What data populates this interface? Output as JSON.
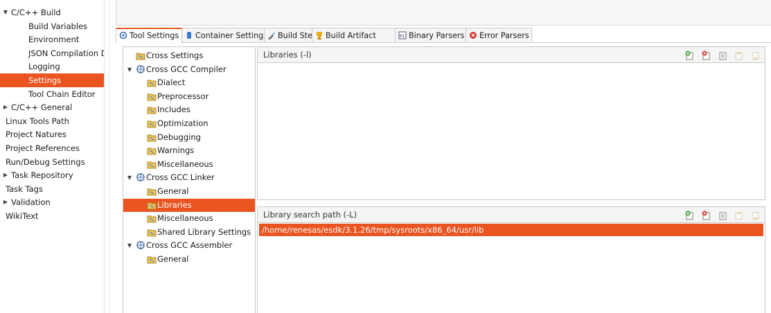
{
  "nav": {
    "items": [
      {
        "label": "C/C++ Build",
        "arrow": "▼",
        "level": 0,
        "selected": false
      },
      {
        "label": "Build Variables",
        "level": 1,
        "selected": false
      },
      {
        "label": "Environment",
        "level": 1,
        "selected": false
      },
      {
        "label": "JSON Compilation D",
        "level": 1,
        "selected": false
      },
      {
        "label": "Logging",
        "level": 1,
        "selected": false
      },
      {
        "label": "Settings",
        "level": 1,
        "selected": true
      },
      {
        "label": "Tool Chain Editor",
        "level": 1,
        "selected": false
      },
      {
        "label": "C/C++ General",
        "arrow": "▶",
        "level": 0,
        "selected": false
      },
      {
        "label": "Linux Tools Path",
        "level": 0,
        "selected": false
      },
      {
        "label": "Project Natures",
        "level": 0,
        "selected": false
      },
      {
        "label": "Project References",
        "level": 0,
        "selected": false
      },
      {
        "label": "Run/Debug Settings",
        "level": 0,
        "selected": false
      },
      {
        "label": "Task Repository",
        "arrow": "▶",
        "level": 0,
        "selected": false
      },
      {
        "label": "Task Tags",
        "level": 0,
        "selected": false
      },
      {
        "label": "Validation",
        "arrow": "▶",
        "level": 0,
        "selected": false
      },
      {
        "label": "WikiText",
        "level": 0,
        "selected": false
      }
    ]
  },
  "tabs": [
    {
      "label": "Tool Settings",
      "icon": "tool-settings-icon",
      "active": true
    },
    {
      "label": "Container Settings",
      "icon": "container-icon",
      "active": false
    },
    {
      "label": "Build Steps",
      "icon": "build-steps-icon",
      "active": false
    },
    {
      "label": "Build Artifact",
      "icon": "build-artifact-icon",
      "active": false
    },
    {
      "label": "Binary Parsers",
      "icon": "binary-parsers-icon",
      "active": false
    },
    {
      "label": "Error Parsers",
      "icon": "error-parsers-icon",
      "active": false
    }
  ],
  "tool_tree": {
    "items": [
      {
        "label": "Cross Settings",
        "kind": "option",
        "level": 0
      },
      {
        "label": "Cross GCC Compiler",
        "kind": "tool",
        "level": 0,
        "arrow": "▼"
      },
      {
        "label": "Dialect",
        "kind": "option",
        "level": 1
      },
      {
        "label": "Preprocessor",
        "kind": "option",
        "level": 1
      },
      {
        "label": "Includes",
        "kind": "option",
        "level": 1
      },
      {
        "label": "Optimization",
        "kind": "option",
        "level": 1
      },
      {
        "label": "Debugging",
        "kind": "option",
        "level": 1
      },
      {
        "label": "Warnings",
        "kind": "option",
        "level": 1
      },
      {
        "label": "Miscellaneous",
        "kind": "option",
        "level": 1
      },
      {
        "label": "Cross GCC Linker",
        "kind": "tool",
        "level": 0,
        "arrow": "▼"
      },
      {
        "label": "General",
        "kind": "option",
        "level": 1
      },
      {
        "label": "Libraries",
        "kind": "option",
        "level": 1,
        "selected": true
      },
      {
        "label": "Miscellaneous",
        "kind": "option",
        "level": 1
      },
      {
        "label": "Shared Library Settings",
        "kind": "option",
        "level": 1
      },
      {
        "label": "Cross GCC Assembler",
        "kind": "tool",
        "level": 0,
        "arrow": "▼"
      },
      {
        "label": "General",
        "kind": "option",
        "level": 1
      }
    ]
  },
  "libraries_panel": {
    "title": "Libraries (-l)",
    "tools": [
      "add-icon",
      "delete-icon",
      "edit-icon",
      "move-up-icon",
      "move-down-icon"
    ],
    "entries": []
  },
  "search_path_panel": {
    "title": "Library search path (-L)",
    "tools": [
      "add-icon",
      "delete-icon",
      "edit-icon",
      "move-up-icon",
      "move-down-icon"
    ],
    "entries": [
      "/home/renesas/esdk/3.1.26/tmp/sysroots/x86_64/usr/lib"
    ]
  },
  "colors": {
    "accent": "#e95420",
    "border": "#c8c8c8",
    "panel_header": "#f5f5f5"
  }
}
